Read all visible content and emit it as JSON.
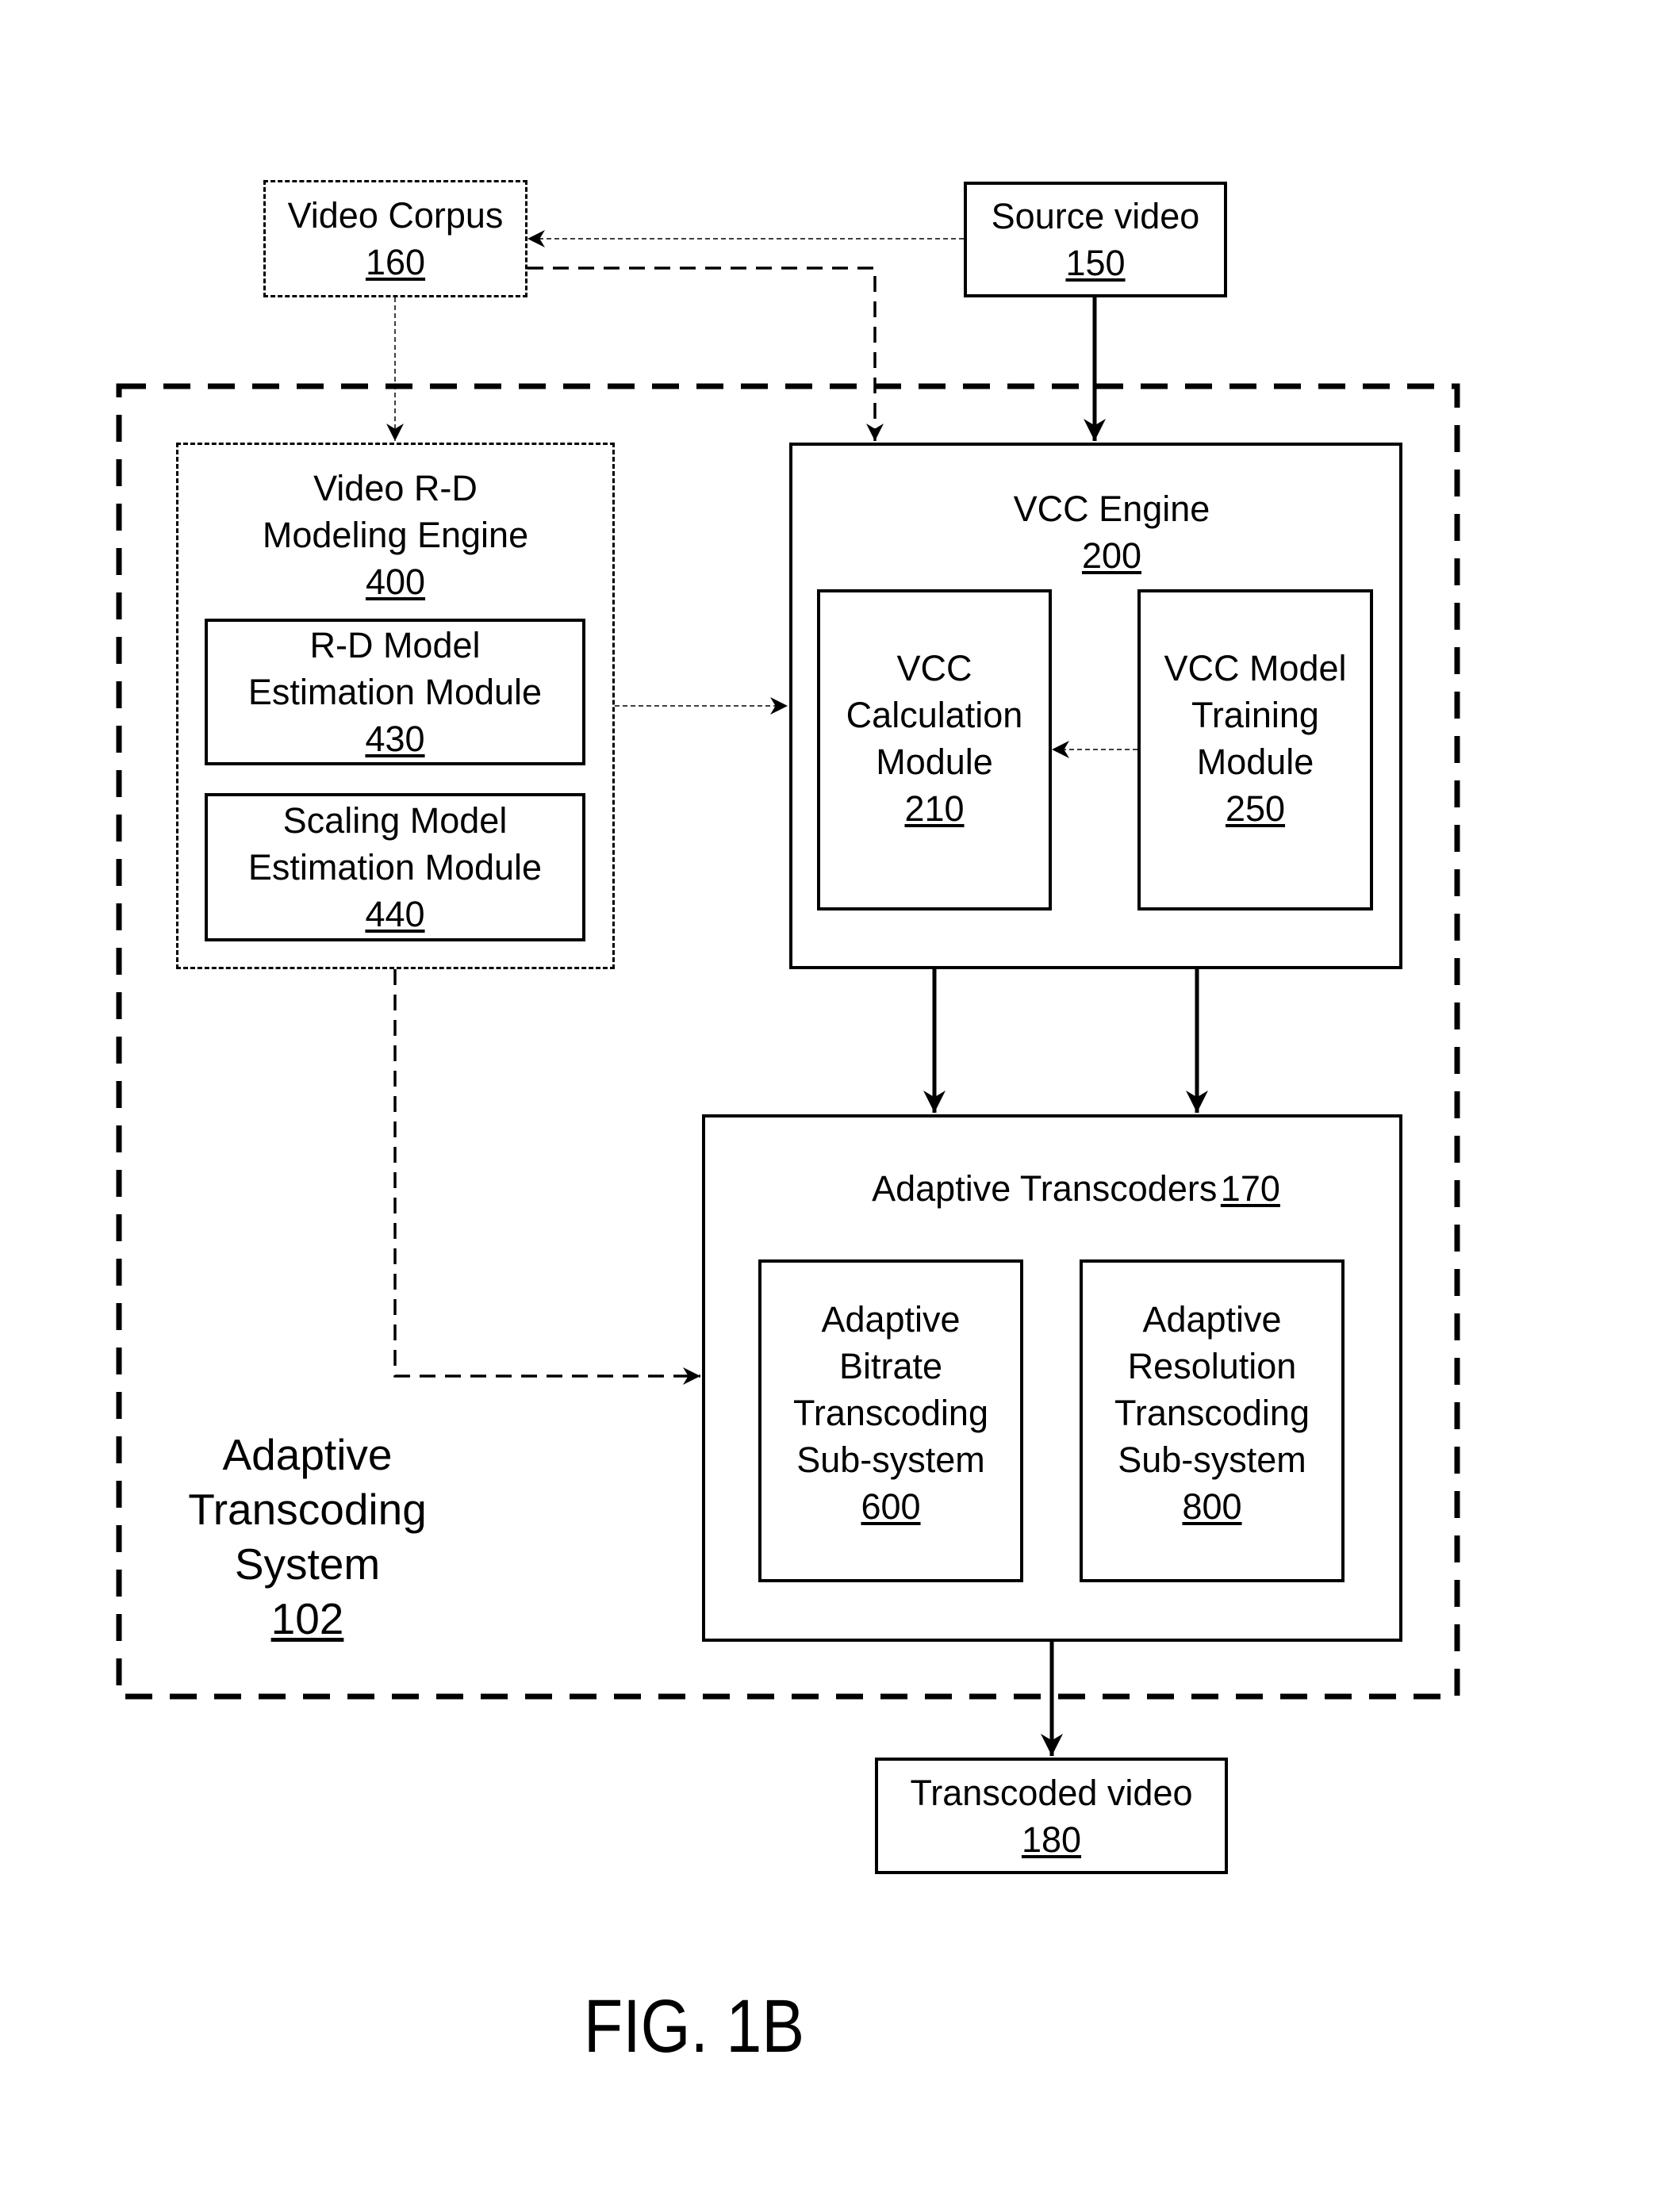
{
  "figure_label": "FIG. 1B",
  "nodes": {
    "video_corpus": {
      "label": "Video Corpus",
      "ref": "160"
    },
    "source_video": {
      "label": "Source video",
      "ref": "150"
    },
    "system": {
      "lines": [
        "Adaptive",
        "Transcoding",
        "System"
      ],
      "ref": "102"
    },
    "rd_engine": {
      "lines": [
        "Video R-D",
        "Modeling Engine"
      ],
      "ref": "400"
    },
    "rd_model": {
      "lines": [
        "R-D Model",
        "Estimation Module"
      ],
      "ref": "430"
    },
    "scaling_model": {
      "lines": [
        "Scaling Model",
        "Estimation Module"
      ],
      "ref": "440"
    },
    "vcc_engine": {
      "label": "VCC Engine",
      "ref": "200"
    },
    "vcc_calc": {
      "lines": [
        "VCC",
        "Calculation",
        "Module"
      ],
      "ref": "210"
    },
    "vcc_training": {
      "lines": [
        "VCC Model",
        "Training",
        "Module"
      ],
      "ref": "250"
    },
    "transcoders": {
      "label": "Adaptive Transcoders",
      "ref": "170"
    },
    "bitrate": {
      "lines": [
        "Adaptive",
        "Bitrate",
        "Transcoding",
        "Sub-system"
      ],
      "ref": "600"
    },
    "resolution": {
      "lines": [
        "Adaptive",
        "Resolution",
        "Transcoding",
        "Sub-system"
      ],
      "ref": "800"
    },
    "transcoded_video": {
      "label": "Transcoded video",
      "ref": "180"
    }
  },
  "edges": [
    {
      "from": "source_video",
      "to": "video_corpus",
      "style": "thin-dashed"
    },
    {
      "from": "video_corpus",
      "to": "vcc_engine",
      "style": "dashed"
    },
    {
      "from": "source_video",
      "to": "vcc_engine",
      "style": "solid"
    },
    {
      "from": "video_corpus",
      "to": "rd_engine",
      "style": "thin-dashed"
    },
    {
      "from": "rd_engine",
      "to": "vcc_engine",
      "style": "thin-dashed"
    },
    {
      "from": "vcc_training",
      "to": "vcc_calc",
      "style": "thin-dashed"
    },
    {
      "from": "vcc_engine",
      "to": "transcoders",
      "style": "solid"
    },
    {
      "from": "vcc_engine",
      "to": "transcoders",
      "style": "solid"
    },
    {
      "from": "rd_engine",
      "to": "transcoders",
      "style": "dashed"
    },
    {
      "from": "transcoders",
      "to": "transcoded_video",
      "style": "solid"
    }
  ]
}
